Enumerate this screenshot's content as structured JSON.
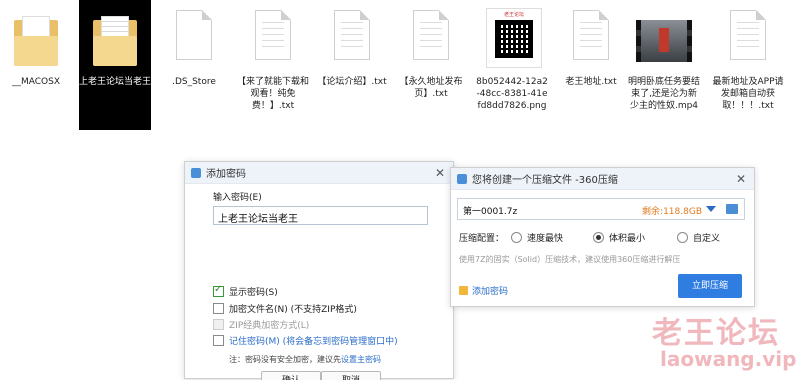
{
  "files": [
    {
      "label": "__MACOSX",
      "icon": "folder-icon"
    },
    {
      "label": "上老王论坛当老王",
      "icon": "folder-icon"
    },
    {
      "label": ".DS_Store",
      "icon": "file-icon"
    },
    {
      "label": "【来了就能下载和观看！纯免费！】.txt",
      "icon": "text-file-icon"
    },
    {
      "label": "【论坛介绍】.txt",
      "icon": "text-file-icon"
    },
    {
      "label": "【永久地址发布页】.txt",
      "icon": "text-file-icon"
    },
    {
      "label": "8b052442-12a2-48cc-8381-41efd8dd7826.png",
      "icon": "image-file-icon"
    },
    {
      "label": "老王地址.txt",
      "icon": "text-file-icon"
    },
    {
      "label": "明明卧底任务要结束了,还是沦为新少主的性奴.mp4",
      "icon": "video-file-icon"
    },
    {
      "label": "最新地址及APP请发邮箱自动获取！！！.txt",
      "icon": "text-file-icon"
    }
  ],
  "qr_caption": "老王论坛",
  "add_password": {
    "title": "添加密码",
    "input_label": "输入密码(E)",
    "password_value": "上老王论坛当老王",
    "show_password": "显示密码(S)",
    "encrypt_filenames": "加密文件名(N) (不支持ZIP格式)",
    "zip_classic": "ZIP经典加密方式(L)",
    "remember": "记住密码(M) (将会备忘到密码管理窗口中)",
    "note_prefix": "注：密码没有安全加密，建议先",
    "note_link": "设置主密码",
    "ok": "确认",
    "cancel": "取消"
  },
  "compress": {
    "title": "您将创建一个压缩文件 -360压缩",
    "archive_name": "第一0001.7z",
    "free_space": "剩余:118.8GB",
    "config_label": "压缩配置：",
    "options": [
      "速度最快",
      "体积最小",
      "自定义"
    ],
    "selected_option": "体积最小",
    "hint": "使用7Z的固实（Solid）压缩技术，建议使用360压缩进行解压",
    "add_password": "添加密码",
    "compress_now": "立即压缩"
  },
  "watermark": {
    "cn": "老王论坛",
    "url": "laowang.vip"
  }
}
